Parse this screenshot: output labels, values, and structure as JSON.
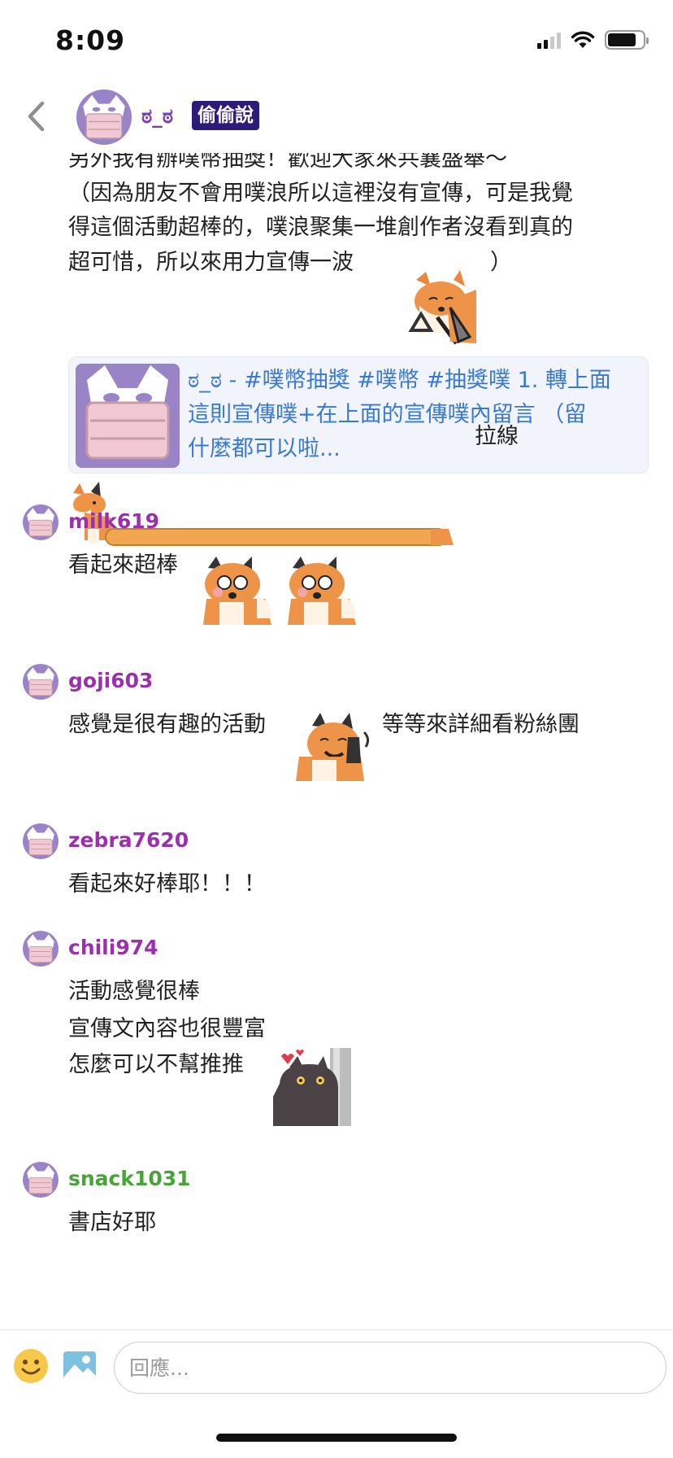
{
  "status_bar": {
    "time": "8:09",
    "battery_level": 0.8
  },
  "header": {
    "title": "ಠ_ಠ",
    "badge": "偷偷說",
    "back_icon": "chevron-left-icon"
  },
  "post": {
    "lines": [
      "另外我有辦噗幣抽獎！歡迎大家來共襄盛舉～",
      "（因為朋友不會用噗浪所以這裡沒有宣傳，可是我覺",
      "得這個活動超棒的，噗浪聚集一堆創作者沒看到真的",
      "超可惜，所以來用力宣傳一波"
    ],
    "after_sticker": "）",
    "link_card": {
      "lines": [
        "ಠ_ಠ - #噗幣抽獎 #噗幣 #抽獎噗 1. 轉上面",
        "這則宣傳噗+在上面的宣傳噗內留言 （留",
        "什麼都可以啦..."
      ]
    },
    "trailing_text": "拉線"
  },
  "comments": [
    {
      "name": "milk619",
      "name_color": "#9b2fae",
      "lines": [
        "看起來超棒"
      ]
    },
    {
      "name": "goji603",
      "name_color": "#9b2fae",
      "lines": [
        "感覺是很有趣的活動"
      ],
      "after_sticker": "等等來詳細看粉絲團"
    },
    {
      "name": "zebra7620",
      "name_color": "#9b2fae",
      "lines": [
        "看起來好棒耶！！！"
      ]
    },
    {
      "name": "chili974",
      "name_color": "#9b2fae",
      "lines": [
        "活動感覺很棒",
        "宣傳文內容也很豐富",
        "怎麼可以不幫推推"
      ]
    },
    {
      "name": "snack1031",
      "name_color": "#4aa33a",
      "lines": [
        "書店好耶"
      ]
    }
  ],
  "input": {
    "placeholder": "回應..."
  },
  "colors": {
    "accent": "#7b3fb3",
    "badge_bg": "#2d1b7a",
    "link": "#3a78d6",
    "avatar_bg": "#9a84c8",
    "mask_pink": "#f0c9d3"
  }
}
